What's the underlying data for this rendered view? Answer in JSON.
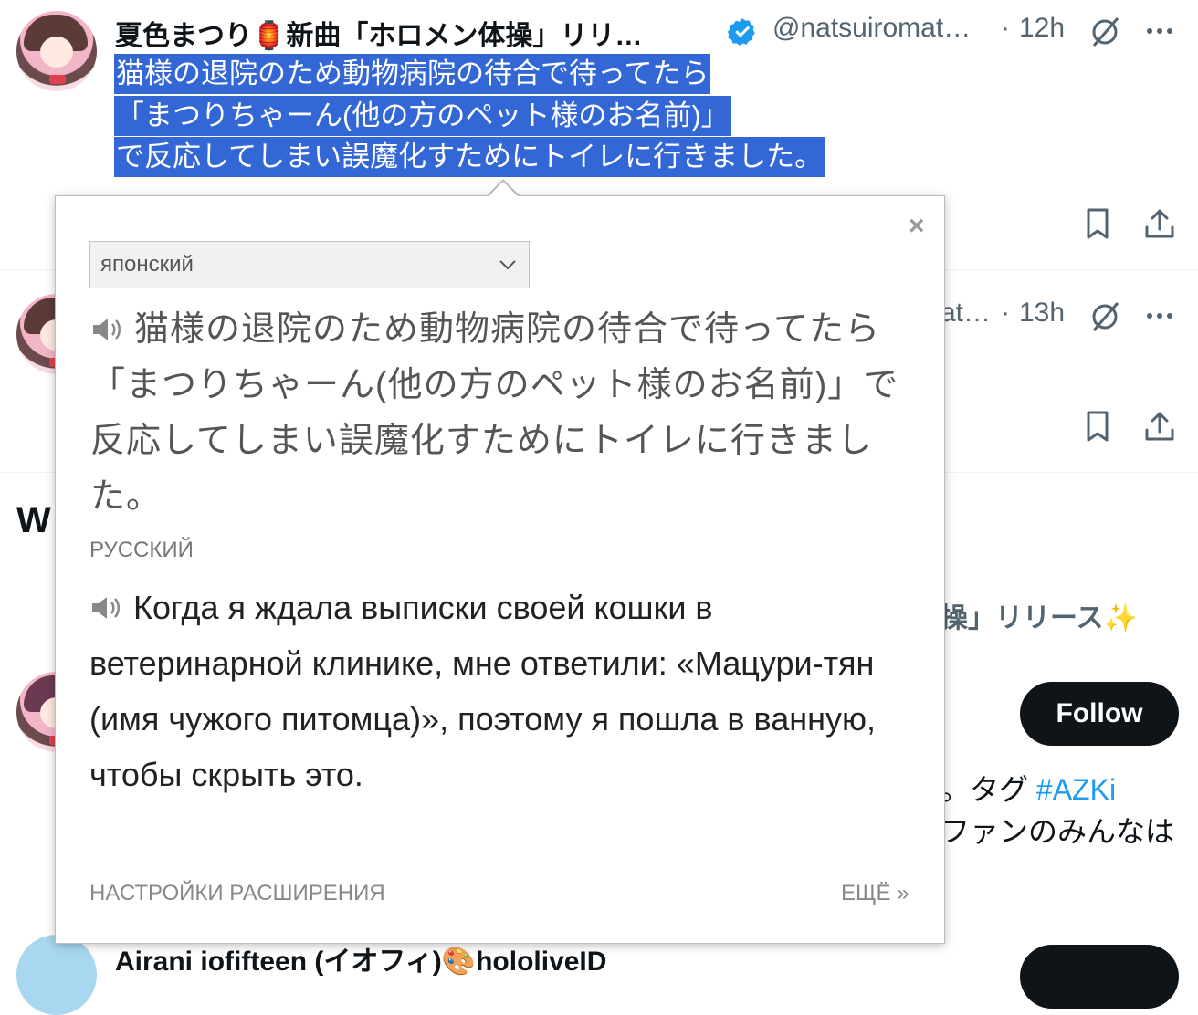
{
  "tweet1": {
    "display_name": "夏色まつり🏮新曲「ホロメン体操」リリ…",
    "handle": "@natsuiromat…",
    "separator": "·",
    "time": "12h",
    "selected_lines": [
      "猫様の退院のため動物病院の待合で待ってたら",
      "「まつりちゃーん(他の方のペット様のお名前)」",
      "で反応してしまい誤魔化すためにトイレに行きました。"
    ]
  },
  "tweet2": {
    "handle": "at…",
    "separator": "·",
    "time": "13h"
  },
  "section_heading_fragment": "W",
  "who_to_follow": {
    "name_fragment_1": "操」リリース✨",
    "follow_label": "Follow",
    "bio_line_1_prefix": "。タグ",
    "bio_line_1_tag": "#AZKi",
    "bio_line_2": "ファンのみんなは",
    "next_name": "Airani iofifteen (イオフィ)🎨hololiveID"
  },
  "popup": {
    "source_language": "японский",
    "close_glyph": "×",
    "source_text": "猫様の退院のため動物病院の待合で待ってたら「まつりちゃーん(他の方のペット様のお名前)」で反応してしまい誤魔化すためにトイレに行きました。",
    "target_language_label": "РУССКИЙ",
    "translation": "Когда я ждала выписки своей кошки в ветеринарной клинике, мне ответили: «Мацури-тян (имя чужого питомца)», поэтому я пошла в ванную, чтобы скрыть это.",
    "settings_link": "НАСТРОЙКИ РАСШИРЕНИЯ",
    "more_link": "ЕЩЁ »"
  },
  "colors": {
    "selection": "#3367d6",
    "verified": "#1d9bf0",
    "hashtag": "#1d9bf0",
    "follow_bg": "#0f1419"
  }
}
